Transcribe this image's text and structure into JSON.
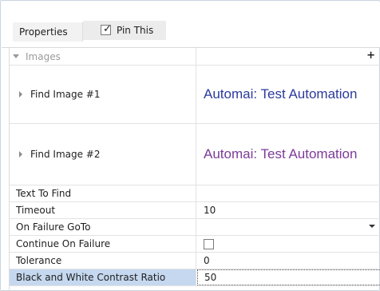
{
  "toolbar": {
    "properties_label": "Properties",
    "pin_label": "Pin This",
    "pin_checked": true
  },
  "category": {
    "label": "Images",
    "add_symbol": "+"
  },
  "images": [
    {
      "label": "Find Image #1",
      "preview_text": "Automai: Test Automation",
      "preview_color": "#2a3a9c"
    },
    {
      "label": "Find Image #2",
      "preview_text": "Automai: Test Automation",
      "preview_color": "#7d3a9a"
    }
  ],
  "properties": {
    "text_to_find": {
      "label": "Text To Find",
      "value": ""
    },
    "timeout": {
      "label": "Timeout",
      "value": "10"
    },
    "on_failure_goto": {
      "label": "On Failure GoTo",
      "value": ""
    },
    "continue_on_failure": {
      "label": "Continue On Failure",
      "checked": false
    },
    "tolerance": {
      "label": "Tolerance",
      "value": "0"
    },
    "bw_contrast": {
      "label": "Black and White Contrast Ratio",
      "value": "50"
    }
  },
  "colors": {
    "selection": "#c5d8ef",
    "grid_line": "#e3e3e3"
  }
}
